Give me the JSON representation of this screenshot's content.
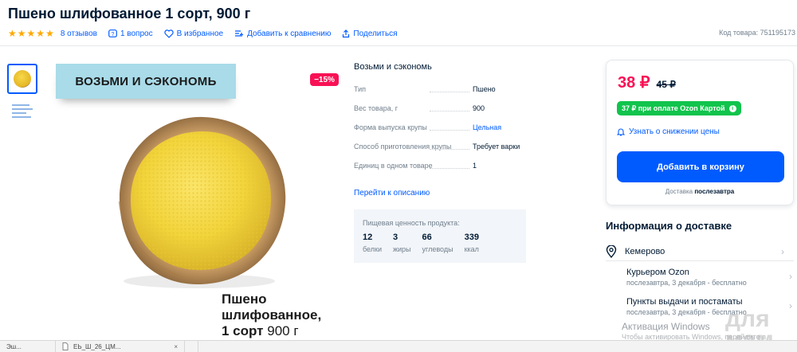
{
  "product": {
    "title": "Пшено шлифованное 1 сорт, 900 г",
    "rating_stars": 5,
    "reviews": "8 отзывов",
    "questions": "1 вопрос",
    "favorites": "В избранное",
    "compare": "Добавить к сравнению",
    "share": "Поделиться",
    "code": "Код товара: 751195173"
  },
  "gallery": {
    "promo_banner": "ВОЗЬМИ И СЭКОНОМЬ",
    "discount_badge": "−15%",
    "overlay_name_line1": "Пшено",
    "overlay_name_line2": "шлифованное,",
    "overlay_name_line3_bold": "1 сорт",
    "overlay_name_line3_light": " 900 г"
  },
  "specs": {
    "heading": "Возьми и сэкономь",
    "rows": [
      {
        "key": "Тип",
        "value": "Пшено",
        "link": false
      },
      {
        "key": "Вес товара, г",
        "value": "900",
        "link": false
      },
      {
        "key": "Форма выпуска крупы",
        "value": "Цельная",
        "link": true
      },
      {
        "key": "Способ приготовления крупы",
        "value": "Требует варки",
        "link": false
      },
      {
        "key": "Единиц в одном товаре",
        "value": "1",
        "link": false
      }
    ],
    "to_description": "Перейти к описанию"
  },
  "nutrition": {
    "title": "Пищевая ценность продукта:",
    "items": [
      {
        "value": "12",
        "label": "белки"
      },
      {
        "value": "3",
        "label": "жиры"
      },
      {
        "value": "66",
        "label": "углеводы"
      },
      {
        "value": "339",
        "label": "ккал"
      }
    ]
  },
  "buy": {
    "price": "38 ₽",
    "old_price": "45 ₽",
    "ozon_card": "37 ₽ при оплате Ozon Картой",
    "notify": "Узнать о снижении цены",
    "add_to_cart": "Добавить в корзину",
    "delivery_prefix": "Доставка ",
    "delivery_when": "послезавтра"
  },
  "shipping": {
    "title": "Информация о доставке",
    "city": "Кемерово",
    "options": [
      {
        "name": "Курьером Ozon",
        "detail": "послезавтра, 3 декабря - бесплатно"
      },
      {
        "name": "Пункты выдачи и постаматы",
        "detail": "послезавтра, 3 декабря - бесплатно"
      }
    ]
  },
  "overlay": {
    "windows_activation": "Активация Windows",
    "windows_activation_sub": "Чтобы активировать Windows, перейдите в",
    "site_mark": "для мам"
  },
  "taskbar": {
    "items": [
      "Эш...",
      "ЕЬ_Ш_26_ЦМ...",
      ""
    ]
  },
  "colors": {
    "accent": "#005bff",
    "price": "#f91155",
    "ozon_green": "#10c44c",
    "stars": "#ffa800"
  }
}
